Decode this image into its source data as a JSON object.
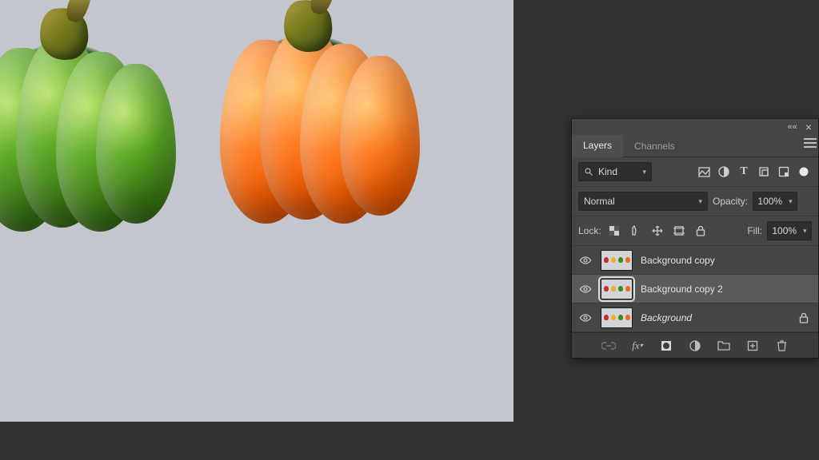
{
  "panel": {
    "tabs": [
      {
        "label": "Layers",
        "active": true
      },
      {
        "label": "Channels",
        "active": false
      }
    ],
    "filter": {
      "search_icon": "search-icon",
      "kind_label": "Kind",
      "type_icons": [
        "pixel-filter-icon",
        "adjustment-filter-icon",
        "type-filter-icon",
        "shape-filter-icon",
        "smartobject-filter-icon",
        "artboard-filter-icon"
      ]
    },
    "blend": {
      "mode": "Normal",
      "opacity_label": "Opacity:",
      "opacity_value": "100%"
    },
    "lock": {
      "label": "Lock:",
      "fill_label": "Fill:",
      "fill_value": "100%",
      "icons": [
        "lock-transparent-icon",
        "lock-image-icon",
        "lock-position-icon",
        "lock-artboard-icon",
        "lock-all-icon"
      ]
    },
    "layers": [
      {
        "name": "Background copy",
        "selected": false,
        "locked": false,
        "italic": false
      },
      {
        "name": "Background copy 2",
        "selected": true,
        "locked": false,
        "italic": false
      },
      {
        "name": "Background",
        "selected": false,
        "locked": true,
        "italic": true
      }
    ],
    "footer_icons": [
      "link-icon",
      "fx-icon",
      "mask-icon",
      "adjustment-icon",
      "group-icon",
      "new-layer-icon",
      "delete-icon"
    ]
  },
  "icons": {
    "collapse": "««",
    "close": "×"
  },
  "canvas": {
    "bg": "#c3c6cc",
    "subjects": [
      "green-bell-pepper",
      "orange-bell-pepper"
    ]
  }
}
